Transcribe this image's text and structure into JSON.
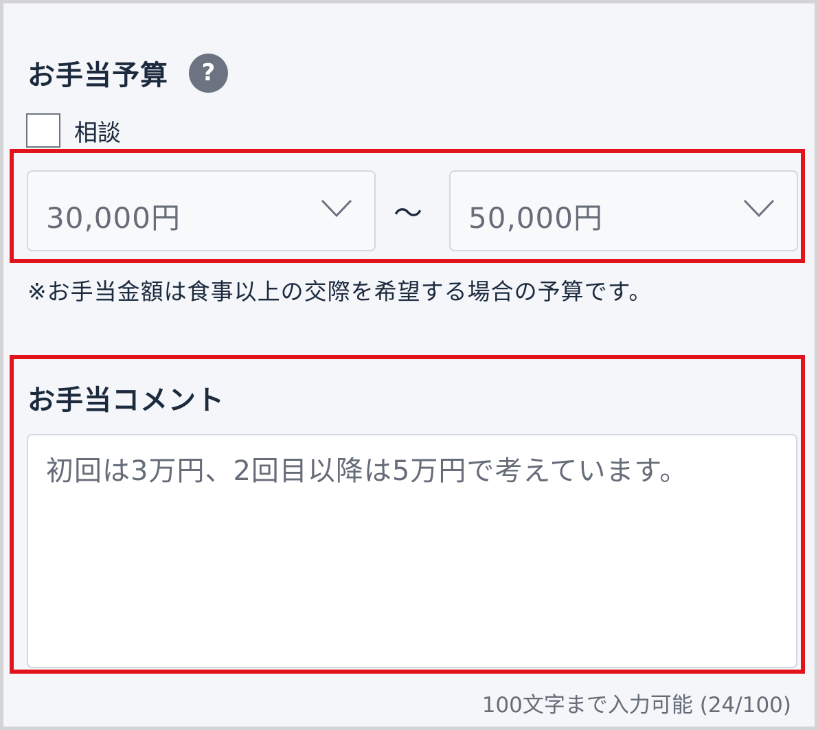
{
  "budget": {
    "title": "お手当予算",
    "help_icon": "?",
    "consult_label": "相談",
    "min_value": "30,000円",
    "separator": "〜",
    "max_value": "50,000円",
    "note": "※お手当金額は食事以上の交際を希望する場合の予算です。"
  },
  "comment": {
    "title": "お手当コメント",
    "text": "初回は3万円、2回目以降は5万円で考えています。",
    "counter": "100文字まで入力可能 (24/100)"
  },
  "colors": {
    "highlight": "#e2141b",
    "title_text": "#1c2a3e",
    "muted_text": "#666c78",
    "background": "#f4f6f9"
  }
}
